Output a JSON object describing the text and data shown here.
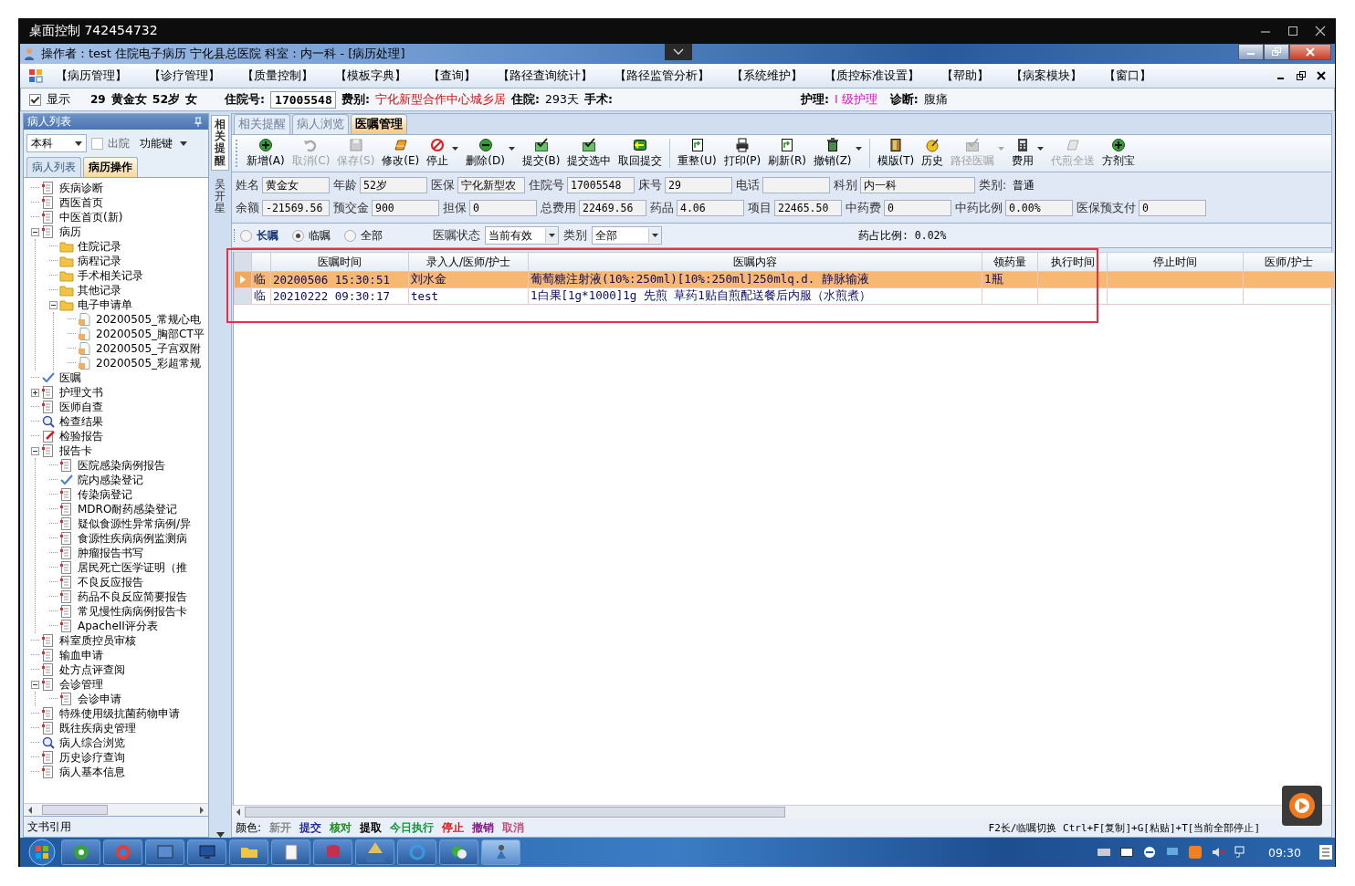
{
  "remote_window": {
    "title": "桌面控制 742454732"
  },
  "app_window": {
    "title": "操作者：test 住院电子病历  宁化县总医院  科室：内一科 - [病历处理]"
  },
  "menu": [
    "【病历管理】",
    "【诊疗管理】",
    "【质量控制】",
    "【模板字典】",
    "【查询】",
    "【路径查询统计】",
    "【路径监管分析】",
    "【系统维护】",
    "【质控标准设置】",
    "【帮助】",
    "【病案模块】",
    "【窗口】"
  ],
  "info_bar": {
    "show": {
      "label": "显示",
      "checked": true
    },
    "bed": "29",
    "name": "黄金女",
    "age": "52岁",
    "sex": "女",
    "admission_label": "住院号:",
    "admission_no": "17005548",
    "fee_label": "费别:",
    "fee_type": "宁化新型合作中心城乡居",
    "stay_label": "住院:",
    "stay": "293天",
    "surgery_label": "手术:",
    "nursing_label": "护理:",
    "nursing": "I 级护理",
    "diagnosis_label": "诊断:",
    "diagnosis": "腹痛"
  },
  "patient_panel": {
    "title": "病人列表",
    "scope": "本科",
    "discharged": {
      "label": "出院",
      "checked": false
    },
    "function_keys": "功能键",
    "tabs": [
      {
        "label": "病人列表",
        "selected": false
      },
      {
        "label": "病历操作",
        "selected": true
      }
    ],
    "tree": [
      {
        "label": "疾病诊断",
        "kind": "doc"
      },
      {
        "label": "西医首页",
        "kind": "doc"
      },
      {
        "label": "中医首页(新)",
        "kind": "doc"
      },
      {
        "label": "病历",
        "kind": "doc",
        "expanded": true,
        "children": [
          {
            "label": "住院记录",
            "kind": "folder"
          },
          {
            "label": "病程记录",
            "kind": "folder"
          },
          {
            "label": "手术相关记录",
            "kind": "folder"
          },
          {
            "label": "其他记录",
            "kind": "folder"
          },
          {
            "label": "电子申请单",
            "kind": "folder",
            "expanded": true,
            "children": [
              {
                "label": "20200505_常规心电",
                "kind": "file"
              },
              {
                "label": "20200505_胸部CT平",
                "kind": "file"
              },
              {
                "label": "20200505_子宫双附",
                "kind": "file"
              },
              {
                "label": "20200505_彩超常规",
                "kind": "file"
              }
            ]
          }
        ]
      },
      {
        "label": "医嘱",
        "kind": "check"
      },
      {
        "label": "护理文书",
        "kind": "doc",
        "expanded": false
      },
      {
        "label": "医师自查",
        "kind": "doc"
      },
      {
        "label": "检查结果",
        "kind": "search"
      },
      {
        "label": "检验报告",
        "kind": "edit"
      },
      {
        "label": "报告卡",
        "kind": "doc",
        "expanded": true,
        "children": [
          {
            "label": "医院感染病例报告",
            "kind": "doc"
          },
          {
            "label": "院内感染登记",
            "kind": "check"
          },
          {
            "label": "传染病登记",
            "kind": "doc"
          },
          {
            "label": "MDRO耐药感染登记",
            "kind": "doc"
          },
          {
            "label": "疑似食源性异常病例/异",
            "kind": "doc"
          },
          {
            "label": "食源性疾病病例监测病",
            "kind": "doc"
          },
          {
            "label": "肿瘤报告书写",
            "kind": "doc"
          },
          {
            "label": "居民死亡医学证明（推",
            "kind": "doc"
          },
          {
            "label": "不良反应报告",
            "kind": "doc"
          },
          {
            "label": "药品不良反应简要报告",
            "kind": "doc"
          },
          {
            "label": "常见慢性病病例报告卡",
            "kind": "doc"
          },
          {
            "label": "ApacheII评分表",
            "kind": "doc"
          }
        ]
      },
      {
        "label": "科室质控员审核",
        "kind": "doc"
      },
      {
        "label": "输血申请",
        "kind": "doc"
      },
      {
        "label": "处方点评查阅",
        "kind": "doc"
      },
      {
        "label": "会诊管理",
        "kind": "doc",
        "expanded": true,
        "children": [
          {
            "label": "会诊申请",
            "kind": "doc"
          }
        ]
      },
      {
        "label": "特殊使用级抗菌药物申请",
        "kind": "doc"
      },
      {
        "label": "既往疾病史管理",
        "kind": "doc"
      },
      {
        "label": "病人综合浏览",
        "kind": "search"
      },
      {
        "label": "历史诊疗查询",
        "kind": "doc"
      },
      {
        "label": "病人基本信息",
        "kind": "doc"
      }
    ],
    "footer": "文书引用"
  },
  "side_tabs": [
    {
      "label": "相关提醒",
      "selected": true
    },
    {
      "label": "吴开星",
      "selected": false
    }
  ],
  "tabs": [
    {
      "label": "相关提醒",
      "selected": false
    },
    {
      "label": "病人浏览",
      "selected": false
    },
    {
      "label": "医嘱管理",
      "selected": true
    }
  ],
  "toolbar": [
    [
      {
        "label": "新增(A)",
        "disabled": false,
        "dropdown": false
      },
      {
        "label": "取消(C)",
        "disabled": true,
        "dropdown": false
      },
      {
        "label": "保存(S)",
        "disabled": true,
        "dropdown": false
      },
      {
        "label": "修改(E)",
        "disabled": false,
        "dropdown": false
      },
      {
        "label": "停止",
        "disabled": false,
        "dropdown": true
      },
      {
        "label": "删除(D)",
        "disabled": false,
        "dropdown": true
      },
      {
        "label": "提交(B)",
        "disabled": false,
        "dropdown": false
      },
      {
        "label": "提交选中",
        "disabled": false,
        "dropdown": false
      },
      {
        "label": "取回提交",
        "disabled": false,
        "dropdown": false
      }
    ],
    [
      {
        "label": "重整(U)",
        "disabled": false,
        "dropdown": false
      },
      {
        "label": "打印(P)",
        "disabled": false,
        "dropdown": false
      },
      {
        "label": "刷新(R)",
        "disabled": false,
        "dropdown": false
      },
      {
        "label": "撤销(Z)",
        "disabled": false,
        "dropdown": true
      }
    ],
    [
      {
        "label": "模版(T)",
        "disabled": false,
        "dropdown": false
      },
      {
        "label": "历史",
        "disabled": false,
        "dropdown": false
      },
      {
        "label": "路径医嘱",
        "disabled": true,
        "dropdown": true
      },
      {
        "label": "费用",
        "disabled": false,
        "dropdown": true
      },
      {
        "label": "代煎全送",
        "disabled": true,
        "dropdown": false
      },
      {
        "label": "方剂宝",
        "disabled": false,
        "dropdown": false
      }
    ]
  ],
  "patient_fields": [
    [
      {
        "label": "姓名",
        "value": "黄金女",
        "kind": "box"
      },
      {
        "label": "年龄",
        "value": "52岁",
        "kind": "box"
      },
      {
        "label": "医保",
        "value": "宁化新型农",
        "kind": "box"
      },
      {
        "label": "住院号",
        "value": "17005548",
        "kind": "box"
      },
      {
        "label": "床号",
        "value": "29",
        "kind": "box"
      },
      {
        "label": "电话",
        "kind": "box"
      },
      {
        "label": "科别",
        "value": "内一科",
        "kind": "wide"
      },
      {
        "label": "类别:",
        "value": "普通",
        "kind": "text"
      }
    ],
    [
      {
        "label": "余额",
        "value": "-21569.56",
        "kind": "box"
      },
      {
        "label": "预交金",
        "value": "900",
        "kind": "box"
      },
      {
        "label": "担保",
        "value": "0",
        "kind": "box"
      },
      {
        "label": "总费用",
        "value": "22469.56",
        "kind": "box"
      },
      {
        "label": "药品",
        "value": "4.06",
        "kind": "box"
      },
      {
        "label": "项目",
        "value": "22465.50",
        "kind": "box"
      },
      {
        "label": "中药费",
        "value": "0",
        "kind": "box"
      },
      {
        "label": "中药比例",
        "value": "0.00%",
        "kind": "box"
      },
      {
        "label": "医保预支付",
        "value": "0",
        "kind": "box"
      }
    ]
  ],
  "filter": {
    "order_types": [
      {
        "label": "长嘱",
        "selected": false
      },
      {
        "label": "临嘱",
        "selected": true
      },
      {
        "label": "全部",
        "selected": false
      }
    ],
    "status_label": "医嘱状态",
    "status": "当前有效",
    "category_label": "类别",
    "category": "全部",
    "drug_ratio": "药占比例: 0.02%"
  },
  "orders": {
    "columns": [
      "医嘱时间",
      "录入人/医师/护士",
      "医嘱内容",
      "领药量",
      "执行时间",
      "停止时间",
      "医师/护士"
    ],
    "rows": [
      {
        "selected": true,
        "type": "临",
        "time": "20200506 15:30:51",
        "entered_by": "刘水金",
        "content": "葡萄糖注射液(10%:250ml)[10%:250ml]250mlq.d.  静脉输液",
        "quantity": "1瓶"
      },
      {
        "selected": false,
        "type": "临",
        "time": "20210222 09:30:17",
        "entered_by": "test",
        "content": "1白果[1g*1000]1g 先煎 草药1贴自煎配送餐后内服（水煎煮）"
      }
    ]
  },
  "legend": {
    "label": "颜色:",
    "items": [
      {
        "text": "新开",
        "color": "#8a8a8a"
      },
      {
        "text": "提交",
        "color": "#2a2aa0"
      },
      {
        "text": "核对",
        "color": "#1a8a1a"
      },
      {
        "text": "提取",
        "color": "#000000"
      },
      {
        "text": "今日执行",
        "color": "#10963c"
      },
      {
        "text": "停止",
        "color": "#e01010"
      },
      {
        "text": "撤销",
        "color": "#8a1a8a"
      },
      {
        "text": "取消",
        "color": "#c0507a"
      }
    ]
  },
  "hotkeys": "F2长/临嘱切换 Ctrl+F[复制]+G[粘贴]+T[当前全部停止]",
  "taskbar": {
    "time": "09:30"
  }
}
